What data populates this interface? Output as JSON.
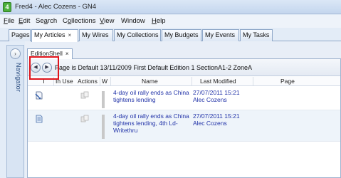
{
  "window": {
    "title": "Fred4 - Alec Cozens - GN4",
    "app_icon_letter": "4"
  },
  "menu": [
    {
      "pre": "",
      "ul": "F",
      "post": "ile"
    },
    {
      "pre": "",
      "ul": "E",
      "post": "dit"
    },
    {
      "pre": "Se",
      "ul": "a",
      "post": "rch"
    },
    {
      "pre": "C",
      "ul": "o",
      "post": "llections"
    },
    {
      "pre": "",
      "ul": "V",
      "post": "iew"
    },
    {
      "pre": "Window",
      "ul": "",
      "post": ""
    },
    {
      "pre": "",
      "ul": "H",
      "post": "elp"
    }
  ],
  "tabs": [
    {
      "label": "Pages"
    },
    {
      "label": "My Articles",
      "close": "×"
    },
    {
      "label": "My Wires"
    },
    {
      "label": "My Collections"
    },
    {
      "label": "My Budgets"
    },
    {
      "label": "My Events"
    },
    {
      "label": "My Tasks"
    }
  ],
  "navigator": {
    "label": "Navigator",
    "expand_glyph": "›"
  },
  "subtab": {
    "label": "EditionShell",
    "close": "×"
  },
  "breadcrumb": {
    "back_glyph": "◀",
    "forward_glyph": "▶",
    "text": "Page is Default 13/11/2009 First Default Edition 1 SectionA1-2 ZoneA"
  },
  "grid": {
    "columns": {
      "type": "T",
      "in_use": "In Use",
      "actions": "Actions",
      "w": "W",
      "name": "Name",
      "last_modified": "Last Modified",
      "page": "Page"
    },
    "rows": [
      {
        "type_icon": "wire-story-icon",
        "name": "4-day oil rally ends as China tightens lending",
        "modified_date": "27/07/2011 15:21",
        "modified_by": "Alec Cozens"
      },
      {
        "type_icon": "article-document-icon",
        "name": "4-day oil rally ends as China tightens lending, 4th Ld-Writethru",
        "modified_date": "27/07/2011 15:21",
        "modified_by": "Alec Cozens"
      }
    ]
  },
  "colors": {
    "highlight_border": "#e0141b",
    "link_text": "#2233a8",
    "chrome_blue": "#c4d6ee"
  }
}
